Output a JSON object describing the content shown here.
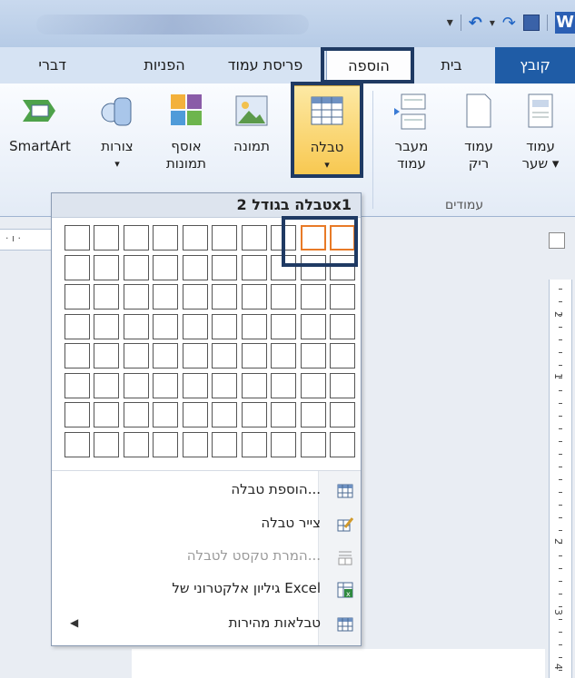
{
  "quick_access": {
    "word_icon_label": "W"
  },
  "tabs": {
    "file": "קובץ",
    "home": "בית",
    "insert": "הוספה",
    "page_layout": "פריסת עמוד",
    "references": "הפניות",
    "mailings": "דברי"
  },
  "ribbon": {
    "cover_page": {
      "line1": "עמוד",
      "line2": "שער ▾"
    },
    "blank_page": {
      "line1": "עמוד",
      "line2": "ריק"
    },
    "page_break": {
      "line1": "מעבר",
      "line2": "עמוד"
    },
    "table": {
      "line1": "טבלה",
      "line2": "▾"
    },
    "picture": {
      "line1": "תמונה",
      "line2": ""
    },
    "clip_art": {
      "line1": "אוסף",
      "line2": "תמונות"
    },
    "shapes": {
      "line1": "צורות",
      "line2": "▾"
    },
    "smartart": {
      "line1": "SmartArt",
      "line2": ""
    },
    "pages_group_label": "עמודים"
  },
  "table_dropdown": {
    "header": "טבלה בגודל 2x1",
    "grid_cols": 10,
    "grid_rows": 8,
    "selected_cols": 2,
    "selected_rows": 1,
    "menu": [
      {
        "label": "הוספת טבלה...",
        "icon": "insert-table-icon",
        "disabled": false
      },
      {
        "label": "צייר טבלה",
        "icon": "draw-table-icon",
        "disabled": false
      },
      {
        "label": "המרת טקסט לטבלה...",
        "icon": "convert-text-icon",
        "disabled": true
      },
      {
        "label": "גיליון אלקטרוני של Excel",
        "icon": "excel-sheet-icon",
        "disabled": false
      },
      {
        "label": "טבלאות מהירות",
        "icon": "quick-tables-icon",
        "disabled": false,
        "submenu": true
      }
    ]
  },
  "ruler": {
    "vertical_numbers": [
      "2",
      "1",
      "2",
      "3",
      "4"
    ]
  },
  "colors": {
    "accent": "#1f5ca6",
    "selection": "#e87a27",
    "highlight": "#1f3a63"
  }
}
